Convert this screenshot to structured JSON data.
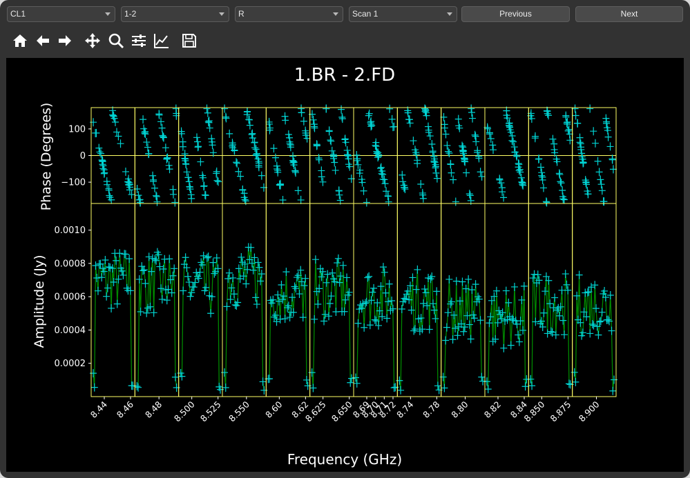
{
  "toolbar": {
    "combos": [
      "CL1",
      "1-2",
      "R",
      "Scan 1"
    ],
    "previous_label": "Previous",
    "next_label": "Next",
    "tools": [
      "home-icon",
      "back-arrow-icon",
      "forward-arrow-icon",
      "pan-icon",
      "zoom-icon",
      "configure-subplots-icon",
      "edit-axes-icon",
      "save-icon"
    ]
  },
  "chart_data": {
    "type": "scatter",
    "title": "1.BR - 2.FD",
    "xlabel": "Frequency (GHz)",
    "colors": {
      "axes": "#ffff66",
      "points": "#00d4d4",
      "line": "#008800",
      "text": "#ffffff",
      "background": "#000000"
    },
    "phase_panel": {
      "ylabel": "Phase (Degrees)",
      "ylim": [
        -180,
        180
      ],
      "yticks": [
        100,
        0,
        -100
      ],
      "zero_line": true,
      "spectral_windows": 12,
      "pattern": "phase wraps steeply with frequency in every spectral window"
    },
    "amplitude_panel": {
      "ylabel": "Amplitude (Jy)",
      "ylim": [
        0,
        0.00116
      ],
      "yticks": [
        "0.0010",
        "0.0008",
        "0.0006",
        "0.0004",
        "0.0002"
      ],
      "windows": [
        {
          "ticks": [
            "8.44",
            "8.46"
          ],
          "mean": 0.0007,
          "edge_low": true
        },
        {
          "ticks": [
            "8.48"
          ],
          "mean": 0.00068,
          "edge_low": true
        },
        {
          "ticks": [
            "8.500",
            "8.525"
          ],
          "mean": 0.00066,
          "edge_low": true
        },
        {
          "ticks": [
            "8.550"
          ],
          "mean": 0.00072,
          "edge_low": true
        },
        {
          "ticks": [
            "8.60",
            "8.62"
          ],
          "mean": 0.00062,
          "edge_low": true
        },
        {
          "ticks": [
            "8.625",
            "8.650"
          ],
          "mean": 0.00064,
          "edge_low": true
        },
        {
          "ticks": [
            "8.69",
            "8.70",
            "8.71",
            "8.72"
          ],
          "mean": 0.0006,
          "edge_low": true
        },
        {
          "ticks": [
            "8.74",
            "8.78"
          ],
          "mean": 0.00058,
          "edge_low": true
        },
        {
          "ticks": [
            "8.80"
          ],
          "mean": 0.00052,
          "edge_low": true
        },
        {
          "ticks": [
            "8.82",
            "8.84"
          ],
          "mean": 0.00048,
          "edge_low": true
        },
        {
          "ticks": [
            "8.850",
            "8.875"
          ],
          "mean": 0.00056,
          "edge_low": true
        },
        {
          "ticks": [
            "8.900"
          ],
          "mean": 0.00055,
          "edge_low": true
        }
      ]
    }
  }
}
